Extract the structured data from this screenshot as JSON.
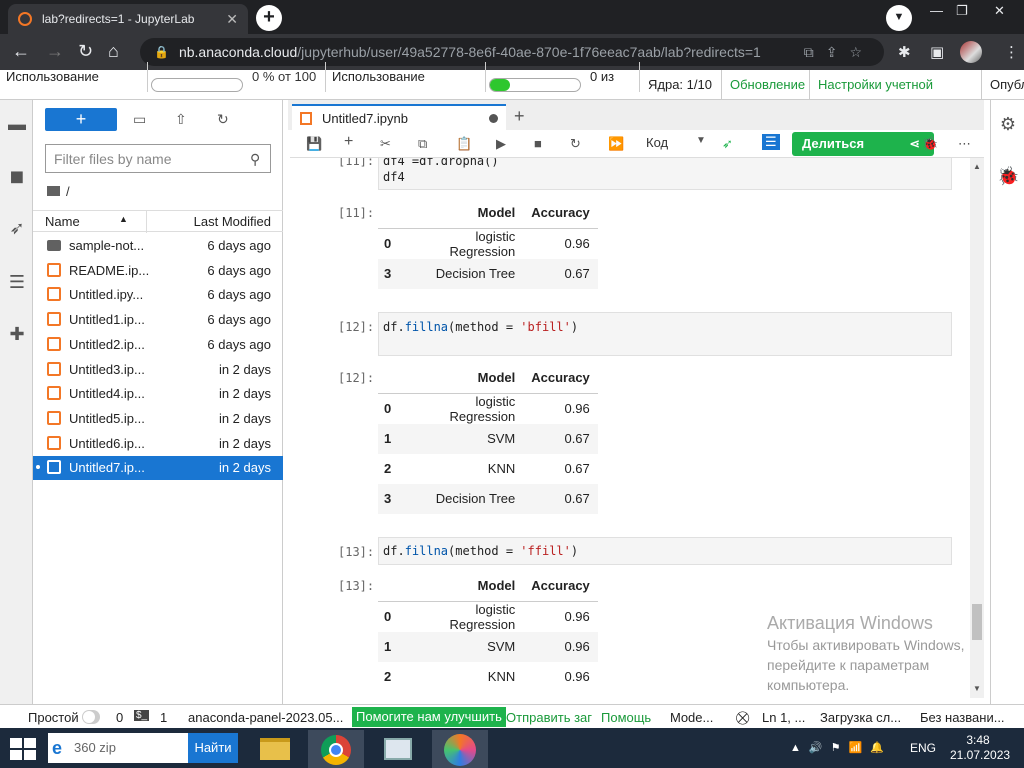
{
  "browser": {
    "tab_title": "lab?redirects=1 - JupyterLab",
    "tab_close": "✕",
    "new_tab": "+",
    "url_host": "nb.anaconda.cloud",
    "url_path": "/jupyterhub/user/49a52778-8e6f-40ae-870e-1f76eeac7aab/lab?redirects=1"
  },
  "jupyter_top": {
    "usage_label": "Использование",
    "usage_value": "0 % от 100",
    "usage2_label": "Использование",
    "usage2_value": "0 из",
    "kernels": "Ядра: 1/10",
    "update": "Обновление",
    "account": "Настройки учетной записи",
    "publish": "Опубл",
    "usage_fill": 0,
    "usage2_fill": 0.22
  },
  "filebrowser": {
    "new_label": "+",
    "filter_placeholder": "Filter files by name",
    "breadcrumb": "/",
    "col_name": "Name",
    "col_modified": "Last Modified",
    "files": [
      {
        "name": "sample-not...",
        "modified": "6 days ago",
        "type": "folder"
      },
      {
        "name": "README.ip...",
        "modified": "6 days ago",
        "type": "notebook"
      },
      {
        "name": "Untitled.ipy...",
        "modified": "6 days ago",
        "type": "notebook"
      },
      {
        "name": "Untitled1.ip...",
        "modified": "6 days ago",
        "type": "notebook"
      },
      {
        "name": "Untitled2.ip...",
        "modified": "6 days ago",
        "type": "notebook"
      },
      {
        "name": "Untitled3.ip...",
        "modified": "in 2 days",
        "type": "notebook"
      },
      {
        "name": "Untitled4.ip...",
        "modified": "in 2 days",
        "type": "notebook"
      },
      {
        "name": "Untitled5.ip...",
        "modified": "in 2 days",
        "type": "notebook"
      },
      {
        "name": "Untitled6.ip...",
        "modified": "in 2 days",
        "type": "notebook"
      },
      {
        "name": "Untitled7.ip...",
        "modified": "in 2 days",
        "type": "notebook",
        "selected": true
      }
    ]
  },
  "notebook": {
    "tab_title": "Untitled7.ipynb",
    "cell_type": "Код",
    "share_label": "Делиться",
    "cells": {
      "c11_prompt": "[11]:",
      "c11_line1": "df4 =df.dropna()",
      "c11_line2": "df4",
      "o11_prompt": "[11]:",
      "c12_prompt": "[12]:",
      "c12_code_a": "df.",
      "c12_code_fn": "fillna",
      "c12_code_b": "(method = ",
      "c12_code_str": "'bfill'",
      "c12_code_c": ")",
      "o12_prompt": "[12]:",
      "c13_prompt": "[13]:",
      "c13_code_a": "df.",
      "c13_code_fn": "fillna",
      "c13_code_b": "(method = ",
      "c13_code_str": "'ffill'",
      "c13_code_c": ")",
      "o13_prompt": "[13]:"
    },
    "tables": {
      "col_model": "Model",
      "col_acc": "Accuracy",
      "t11": [
        {
          "idx": "0",
          "model": "logistic Regression",
          "acc": "0.96"
        },
        {
          "idx": "3",
          "model": "Decision Tree",
          "acc": "0.67"
        }
      ],
      "t12": [
        {
          "idx": "0",
          "model": "logistic Regression",
          "acc": "0.96"
        },
        {
          "idx": "1",
          "model": "SVM",
          "acc": "0.67"
        },
        {
          "idx": "2",
          "model": "KNN",
          "acc": "0.67"
        },
        {
          "idx": "3",
          "model": "Decision Tree",
          "acc": "0.67"
        }
      ],
      "t13": [
        {
          "idx": "0",
          "model": "logistic Regression",
          "acc": "0.96"
        },
        {
          "idx": "1",
          "model": "SVM",
          "acc": "0.96"
        },
        {
          "idx": "2",
          "model": "KNN",
          "acc": "0.96"
        }
      ]
    }
  },
  "watermark": {
    "title": "Активация Windows",
    "line1": "Чтобы активировать Windows,",
    "line2": "перейдите к параметрам",
    "line3": "компьютера."
  },
  "statusbar": {
    "mode": "Простой",
    "n0": "0",
    "n1": "1",
    "env": "anaconda-panel-2023.05...",
    "help": "Помогите нам улучшить",
    "send": "Отправить заг",
    "help2": "Помощь",
    "mode2": "Mode...",
    "pos": "Ln 1, ...",
    "loading": "Загрузка сл...",
    "untitled": "Без названи..."
  },
  "taskbar": {
    "search_value": "360 zip",
    "go_label": "Найти",
    "lang": "ENG",
    "time": "3:48",
    "date": "21.07.2023"
  }
}
